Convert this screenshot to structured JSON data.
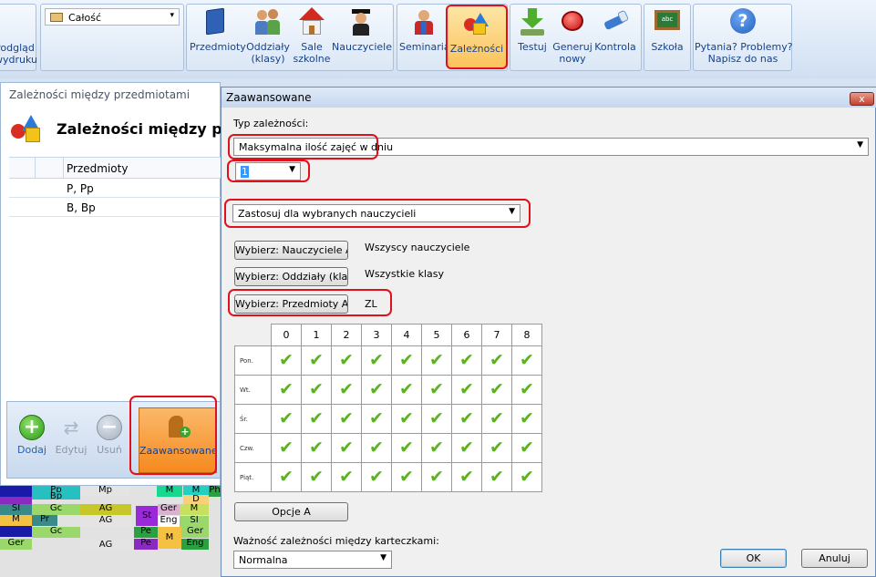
{
  "ribbon": {
    "print_preview_label": "Podgląd\nwydruku",
    "scope_select": "Całość",
    "items": [
      {
        "label": "Przedmioty",
        "icon": "book-icon"
      },
      {
        "label": "Oddziały\n(klasy)",
        "icon": "group-icon"
      },
      {
        "label": "Sale\nszkolne",
        "icon": "house-icon"
      },
      {
        "label": "Nauczyciele",
        "icon": "teacher-icon"
      },
      {
        "label": "Seminaria",
        "icon": "seminar-icon"
      },
      {
        "label": "Zależności",
        "icon": "shapes-icon"
      },
      {
        "label": "Testuj",
        "icon": "download-arrow-icon"
      },
      {
        "label": "Generuj\nnowy",
        "icon": "red-button-icon"
      },
      {
        "label": "Kontrola",
        "icon": "flashlight-icon"
      },
      {
        "label": "Szkoła",
        "icon": "chalkboard-icon"
      },
      {
        "label": "Pytania? Problemy?\nNapisz do nas",
        "icon": "help-icon"
      }
    ]
  },
  "left_panel": {
    "window_title": "Zależności między przedmiotami",
    "heading": "Zależności między prze",
    "column_header": "Przedmioty",
    "rows": [
      "P, Pp",
      "B, Bp"
    ],
    "toolbar": {
      "add": "Dodaj",
      "edit": "Edytuj",
      "delete": "Usuń",
      "advanced": "Zaawansowane"
    }
  },
  "timetable": {
    "cells": [
      "Pp",
      "Bp",
      "Mp",
      "M",
      "M",
      "Ph",
      "D",
      "Gc",
      "AG",
      "St",
      "Ger",
      "M",
      "SI",
      "Pr",
      "AG",
      "Eng",
      "SI",
      "M",
      "Gc",
      "Pe",
      "Ger",
      "M",
      "Ger",
      "AG",
      "Pe",
      "Eng"
    ]
  },
  "dialog": {
    "title": "Zaawansowane",
    "close_glyph": "x",
    "type_label": "Typ zależności:",
    "type_value": "Maksymalna ilość zajęć w dniu",
    "count_value": "1",
    "apply_value": "Zastosuj dla wybranych nauczycieli",
    "pick_teachers_btn": "Wybierz: Nauczyciele A",
    "pick_teachers_val": "Wszyscy nauczyciele",
    "pick_classes_btn": "Wybierz: Oddziały (klasy) A",
    "pick_classes_val": "Wszystkie klasy",
    "pick_subjects_btn": "Wybierz: Przedmioty A",
    "pick_subjects_val": "ZL",
    "grid": {
      "periods": [
        "0",
        "1",
        "2",
        "3",
        "4",
        "5",
        "6",
        "7",
        "8"
      ],
      "days": [
        "Pon.",
        "Wt.",
        "Śr.",
        "Czw.",
        "Piąt."
      ],
      "check_glyph": "✔"
    },
    "options_btn": "Opcje A",
    "importance_label": "Ważność zależności między karteczkami:",
    "importance_value": "Normalna",
    "ok": "OK",
    "cancel": "Anuluj"
  },
  "colors": {
    "highlight": "#e0101c",
    "check": "#5cb21f",
    "selected_tab": "#fbc35c"
  }
}
